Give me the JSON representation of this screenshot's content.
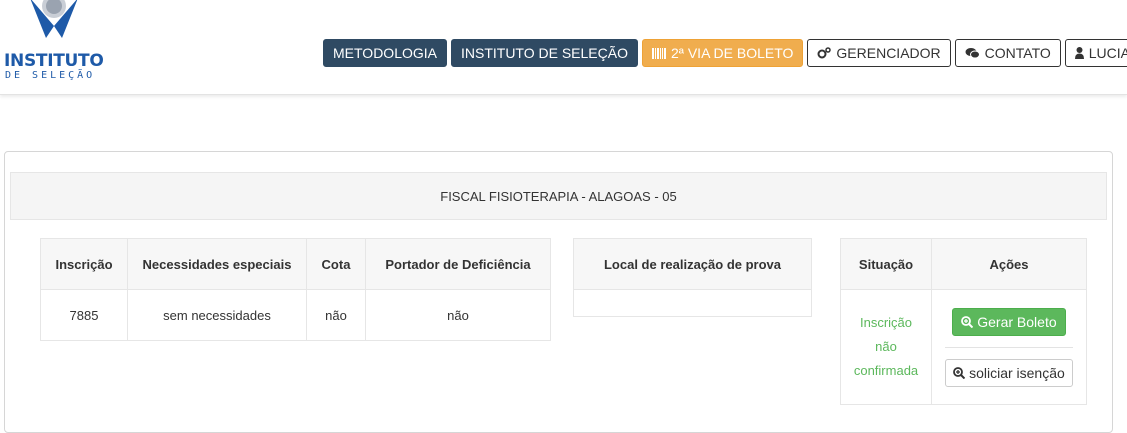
{
  "logo": {
    "name": "INSTITUTO",
    "subtitle": "DE SELEÇÃO"
  },
  "nav": {
    "metodologia": "METODOLOGIA",
    "instituto": "INSTITUTO DE SELEÇÃO",
    "boleto": "2ª VIA DE BOLETO",
    "gerenciador": "GERENCIADOR",
    "contato": "CONTATO",
    "user": "LUCIANA"
  },
  "icons": {
    "boleto": "barcode-icon",
    "gerenciador": "gears-icon",
    "contato": "chat-icon",
    "user": "user-icon",
    "gerar": "zoom-in-icon",
    "isencao": "zoom-in-icon"
  },
  "colors": {
    "primary_dark": "#2f4a63",
    "warning": "#f0ad4e",
    "success": "#5cb85c"
  },
  "panel": {
    "title": "FISCAL FISIOTERAPIA - ALAGOAS - 05"
  },
  "inscricao_table": {
    "headers": [
      "Inscrição",
      "Necessidades especiais",
      "Cota",
      "Portador de Deficiência"
    ],
    "row": [
      "7885",
      "sem necessidades",
      "não",
      "não"
    ]
  },
  "local_table": {
    "header": "Local de realização de prova",
    "value": ""
  },
  "status_table": {
    "headers": [
      "Situação",
      "Ações"
    ],
    "status_lines": [
      "Inscrição",
      "não",
      "confirmada"
    ],
    "gerar_boleto": "Gerar Boleto",
    "solicitar_isencao": "soliciar isenção"
  }
}
